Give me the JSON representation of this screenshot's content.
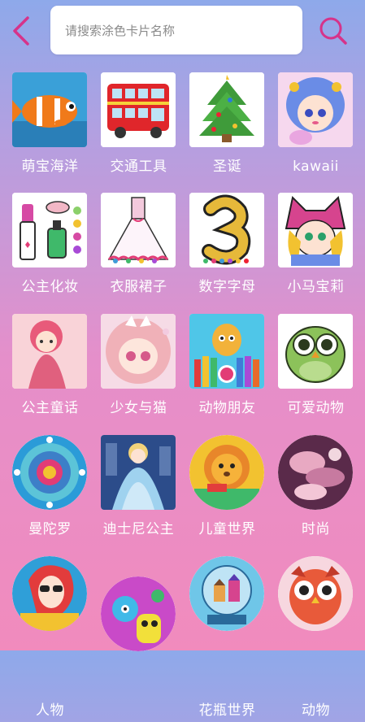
{
  "header": {
    "back_icon": "chevron-left-icon",
    "search_placeholder": "请搜索涂色卡片名称",
    "search_icon": "search-icon",
    "accent_color": "#d6338a"
  },
  "categories": [
    {
      "label": "萌宝海洋",
      "image": "clownfish"
    },
    {
      "label": "交通工具",
      "image": "red-double-decker-bus"
    },
    {
      "label": "圣诞",
      "image": "christmas-tree"
    },
    {
      "label": "kawaii",
      "image": "blue-haired-girl"
    },
    {
      "label": "公主化妆",
      "image": "makeup-lipstick-polish"
    },
    {
      "label": "衣服裙子",
      "image": "rainbow-dress"
    },
    {
      "label": "数字字母",
      "image": "glitter-number-3"
    },
    {
      "label": "小马宝莉",
      "image": "girl-in-cat-hat"
    },
    {
      "label": "公主童话",
      "image": "pink-doll"
    },
    {
      "label": "少女与猫",
      "image": "anime-girl-with-cat"
    },
    {
      "label": "动物朋友",
      "image": "giraffe-with-pencils"
    },
    {
      "label": "可爱动物",
      "image": "green-owl"
    },
    {
      "label": "曼陀罗",
      "image": "blue-mandala"
    },
    {
      "label": "迪士尼公主",
      "image": "cinderella"
    },
    {
      "label": "儿童世界",
      "image": "lion-cartoon"
    },
    {
      "label": "时尚",
      "image": "fashion-flowers"
    },
    {
      "label": "人物",
      "image": "woman-with-sunglasses"
    },
    {
      "label": "",
      "image": "monster-cartoon"
    },
    {
      "label": "花瓶世界",
      "image": "snow-globe-houses"
    },
    {
      "label": "动物",
      "image": "red-owl"
    }
  ]
}
